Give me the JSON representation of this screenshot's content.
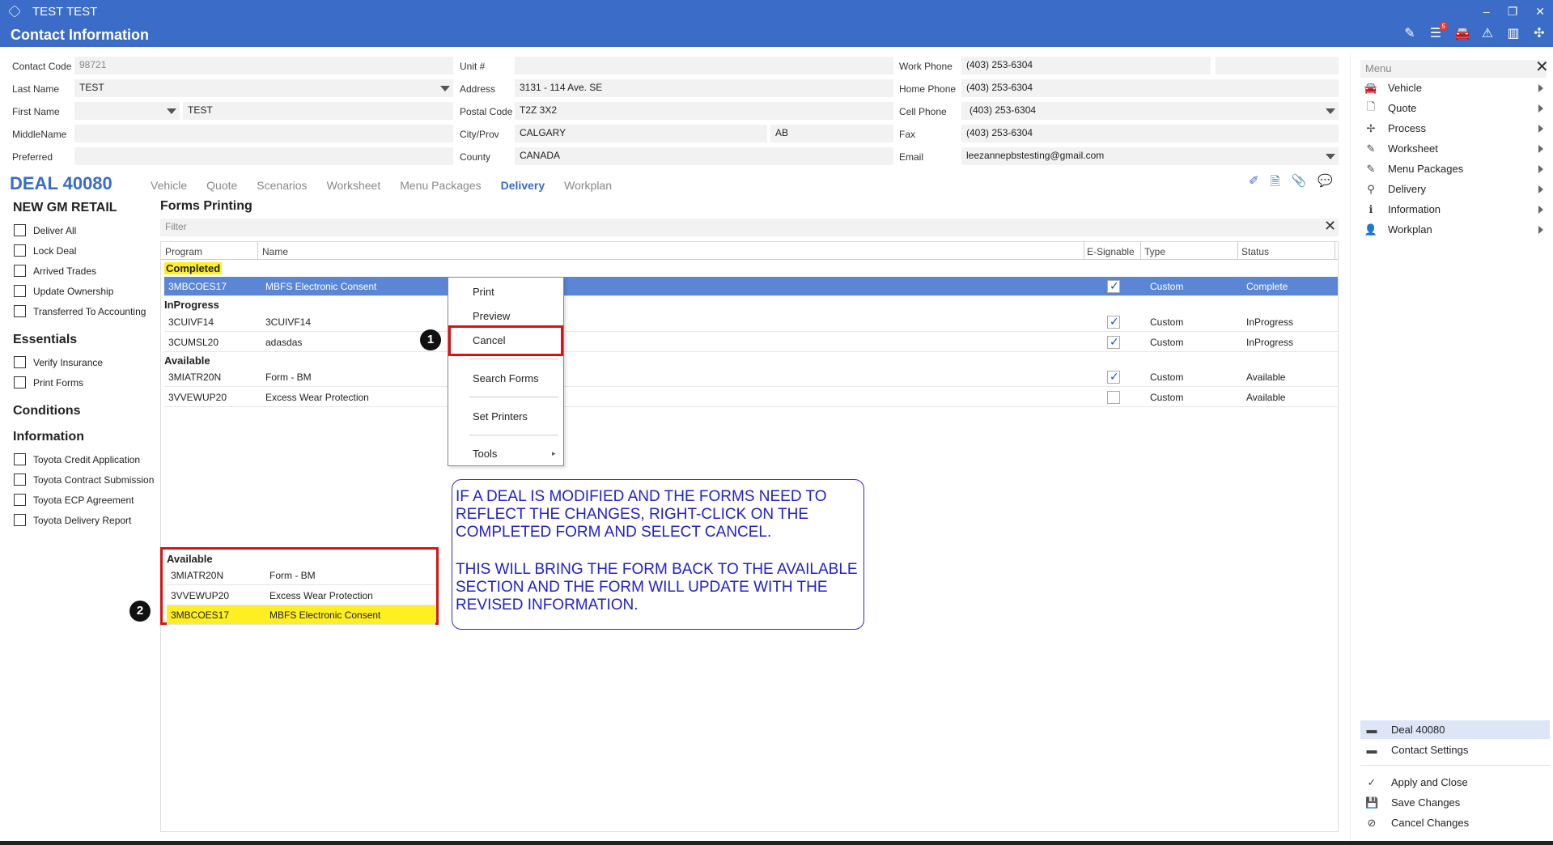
{
  "window": {
    "app_title": "TEST TEST",
    "page_title": "Contact Information",
    "controls": [
      "–",
      "❐",
      "✕"
    ],
    "badge_count": "5"
  },
  "contact": {
    "contact_code_label": "Contact Code",
    "contact_code": "98721",
    "last_name_label": "Last Name",
    "last_name": "TEST",
    "first_name_label": "First Name",
    "first_name": "TEST",
    "middle_name_label": "MiddleName",
    "middle_name": "",
    "preferred_label": "Preferred",
    "preferred": "",
    "unit_label": "Unit #",
    "unit": "",
    "address_label": "Address",
    "address": "3131 - 114 Ave. SE",
    "postal_label": "Postal Code",
    "postal": "T2Z 3X2",
    "city_label": "City/Prov",
    "city": "CALGARY",
    "prov": "AB",
    "county_label": "County",
    "county": "CANADA",
    "work_phone_label": "Work Phone",
    "work_phone": "(403) 253-6304",
    "home_phone_label": "Home Phone",
    "home_phone": "(403) 253-6304",
    "cell_phone_label": "Cell Phone",
    "cell_phone": "(403) 253-6304",
    "fax_label": "Fax",
    "fax": "(403) 253-6304",
    "email_label": "Email",
    "email": "leezannepbstesting@gmail.com"
  },
  "deal": {
    "title": "DEAL 40080",
    "tabs": [
      "Vehicle",
      "Quote",
      "Scenarios",
      "Worksheet",
      "Menu Packages",
      "Delivery",
      "Workplan"
    ],
    "active_tab": "Delivery"
  },
  "left": {
    "retail_title": "NEW GM RETAIL",
    "retail_items": [
      "Deliver All",
      "Lock Deal",
      "Arrived Trades",
      "Update Ownership",
      "Transferred To Accounting"
    ],
    "essentials_title": "Essentials",
    "essentials_items": [
      "Verify Insurance",
      "Print Forms"
    ],
    "conditions_title": "Conditions",
    "information_title": "Information",
    "information_items": [
      "Toyota Credit Application",
      "Toyota Contract Submission",
      "Toyota ECP Agreement",
      "Toyota Delivery Report"
    ]
  },
  "forms": {
    "title": "Forms Printing",
    "filter_placeholder": "Filter",
    "columns": [
      "Program",
      "Name",
      "E-Signable",
      "Type",
      "Status"
    ],
    "completed_label": "Completed",
    "inprogress_label": "InProgress",
    "available_label": "Available",
    "rows": [
      {
        "program": "3MBCOES17",
        "name": "MBFS Electronic Consent",
        "esign": true,
        "type": "Custom",
        "status": "Complete"
      },
      {
        "program": "3CUIVF14",
        "name": "3CUIVF14",
        "esign": true,
        "type": "Custom",
        "status": "InProgress"
      },
      {
        "program": "3CUMSL20",
        "name": "adasdas",
        "esign": true,
        "type": "Custom",
        "status": "InProgress"
      },
      {
        "program": "3MIATR20N",
        "name": "Form - BM",
        "esign": true,
        "type": "Custom",
        "status": "Available"
      },
      {
        "program": "3VVEWUP20",
        "name": "Excess Wear Protection",
        "esign": false,
        "type": "Custom",
        "status": "Available"
      }
    ]
  },
  "context_menu": {
    "items": [
      "Print",
      "Preview",
      "Cancel",
      "Search Forms",
      "Set Printers",
      "Tools"
    ],
    "step1": "1"
  },
  "annotation": {
    "para1": "IF A DEAL IS MODIFIED AND THE FORMS NEED TO REFLECT THE CHANGES, RIGHT-CLICK ON THE COMPLETED FORM AND SELECT CANCEL.",
    "para2": "THIS WILL BRING THE FORM BACK TO THE AVAILABLE SECTION AND THE FORM WILL UPDATE WITH THE REVISED INFORMATION."
  },
  "inset": {
    "title": "Available",
    "step2": "2",
    "rows": [
      {
        "program": "3MIATR20N",
        "name": "Form - BM"
      },
      {
        "program": "3VVEWUP20",
        "name": "Excess Wear Protection"
      },
      {
        "program": "3MBCOES17",
        "name": "MBFS Electronic Consent"
      }
    ]
  },
  "menu": {
    "title": "Menu",
    "items": [
      "Vehicle",
      "Quote",
      "Process",
      "Worksheet",
      "Menu Packages",
      "Delivery",
      "Information",
      "Workplan"
    ],
    "bottom": [
      "Deal 40080",
      "Contact Settings",
      "Apply and Close",
      "Save Changes",
      "Cancel Changes"
    ]
  },
  "colors": {
    "titlebar": "#3a6cc8",
    "accent": "#3a6cc8",
    "selected_row": "#5b86d6",
    "highlight": "#ffee22",
    "annotation_red": "#e01010",
    "note_blue": "#2020d0"
  }
}
